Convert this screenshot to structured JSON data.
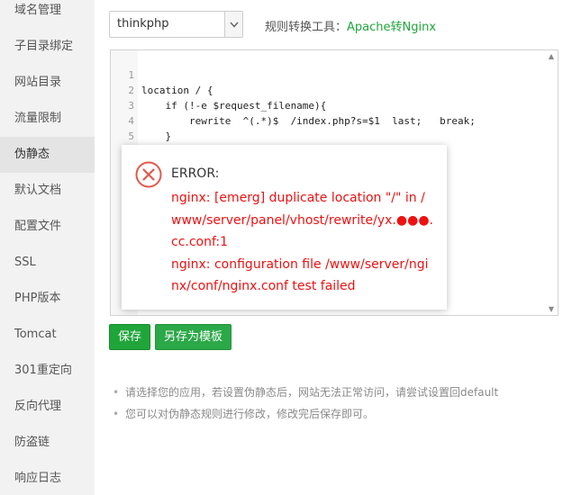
{
  "sidebar": {
    "items": [
      {
        "label": "域名管理"
      },
      {
        "label": "子目录绑定"
      },
      {
        "label": "网站目录"
      },
      {
        "label": "流量限制"
      },
      {
        "label": "伪静态",
        "active": true
      },
      {
        "label": "默认文档"
      },
      {
        "label": "配置文件"
      },
      {
        "label": "SSL"
      },
      {
        "label": "PHP版本"
      },
      {
        "label": "Tomcat"
      },
      {
        "label": "301重定向"
      },
      {
        "label": "反向代理"
      },
      {
        "label": "防盗链"
      },
      {
        "label": "响应日志"
      }
    ]
  },
  "template_select": {
    "value": "thinkphp"
  },
  "converter": {
    "label": "规则转换工具：",
    "link": "Apache转Nginx"
  },
  "editor": {
    "lines": [
      {
        "num": "1",
        "code": "location / {"
      },
      {
        "num": "2",
        "code": "    if (!-e $request_filename){"
      },
      {
        "num": "3",
        "code": "        rewrite  ^(.*)$  /index.php?s=$1  last;   break;"
      },
      {
        "num": "4",
        "code": "    }"
      },
      {
        "num": "5",
        "code": "}"
      }
    ]
  },
  "buttons": {
    "save": "保存",
    "save_as_template": "另存为模板"
  },
  "tips": [
    "请选择您的应用，若设置伪静态后，网站无法正常访问，请尝试设置回default",
    "您可以对伪静态规则进行修改，修改完后保存即可。"
  ],
  "error_dialog": {
    "title": "ERROR:",
    "message_1": "nginx: [emerg] duplicate location \"/\" in /www/server/panel/vhost/rewrite/yx.●●●.cc.conf:1",
    "message_2": "nginx: configuration file /www/server/nginx/conf/nginx.conf test failed"
  },
  "colors": {
    "accent_green": "#20a53a",
    "error_red": "#ee1111"
  },
  "icons": {
    "error": "error-circle-x-icon",
    "dropdown": "chevron-down-icon"
  }
}
